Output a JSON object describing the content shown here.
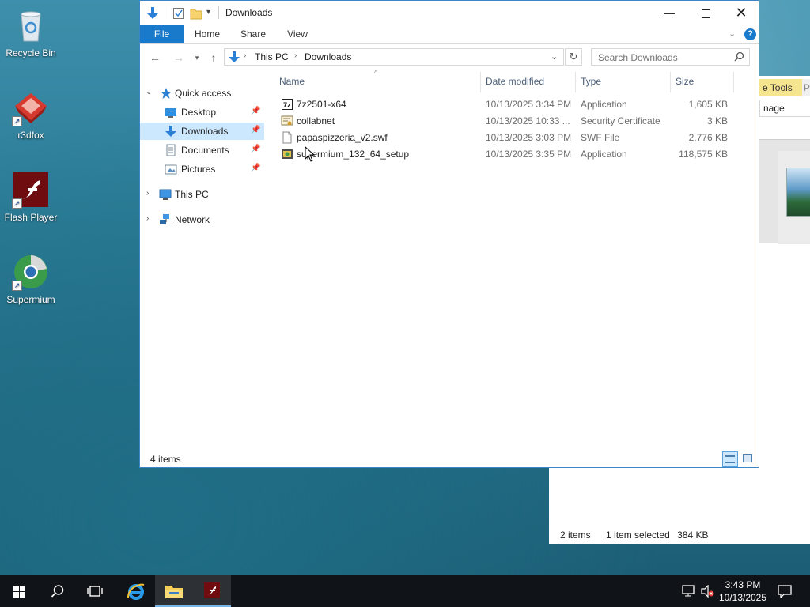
{
  "desktop": {
    "icons": [
      {
        "label": "Recycle Bin",
        "icon": "recycle-bin-icon"
      },
      {
        "label": "r3dfox",
        "icon": "r3dfox-icon"
      },
      {
        "label": "Flash Player",
        "icon": "flash-player-icon"
      },
      {
        "label": "Supermium",
        "icon": "supermium-icon"
      }
    ]
  },
  "background_window": {
    "ribbon_tab": "e Tools",
    "ribbon_tab2": "Pi",
    "manage_label": "nage",
    "status": {
      "items": "2 items",
      "selected": "1 item selected",
      "size": "384 KB"
    }
  },
  "window": {
    "title": "Downloads",
    "ribbon_tabs": [
      "File",
      "Home",
      "Share",
      "View"
    ],
    "address": {
      "crumbs": [
        "This PC",
        "Downloads"
      ]
    },
    "search": {
      "placeholder": "Search Downloads"
    },
    "nav": {
      "quick_access": "Quick access",
      "items": [
        "Desktop",
        "Downloads",
        "Documents",
        "Pictures"
      ],
      "this_pc": "This PC",
      "network": "Network"
    },
    "columns": {
      "name": "Name",
      "date": "Date modified",
      "type": "Type",
      "size": "Size"
    },
    "files": [
      {
        "name": "7z2501-x64",
        "date": "10/13/2025 3:34 PM",
        "type": "Application",
        "size": "1,605 KB",
        "icon": "7zip-installer-icon"
      },
      {
        "name": "collabnet",
        "date": "10/13/2025 10:33 ...",
        "type": "Security Certificate",
        "size": "3 KB",
        "icon": "certificate-icon"
      },
      {
        "name": "papaspizzeria_v2.swf",
        "date": "10/13/2025 3:03 PM",
        "type": "SWF File",
        "size": "2,776 KB",
        "icon": "blank-file-icon"
      },
      {
        "name": "supermium_132_64_setup",
        "date": "10/13/2025 3:35 PM",
        "type": "Application",
        "size": "118,575 KB",
        "icon": "setup-installer-icon"
      }
    ],
    "status": {
      "item_count": "4 items"
    }
  },
  "taskbar": {
    "clock_time": "3:43 PM",
    "clock_date": "10/13/2025"
  },
  "colors": {
    "accent": "#1979ca",
    "selection": "#cce8ff",
    "taskbar": "#101418"
  }
}
